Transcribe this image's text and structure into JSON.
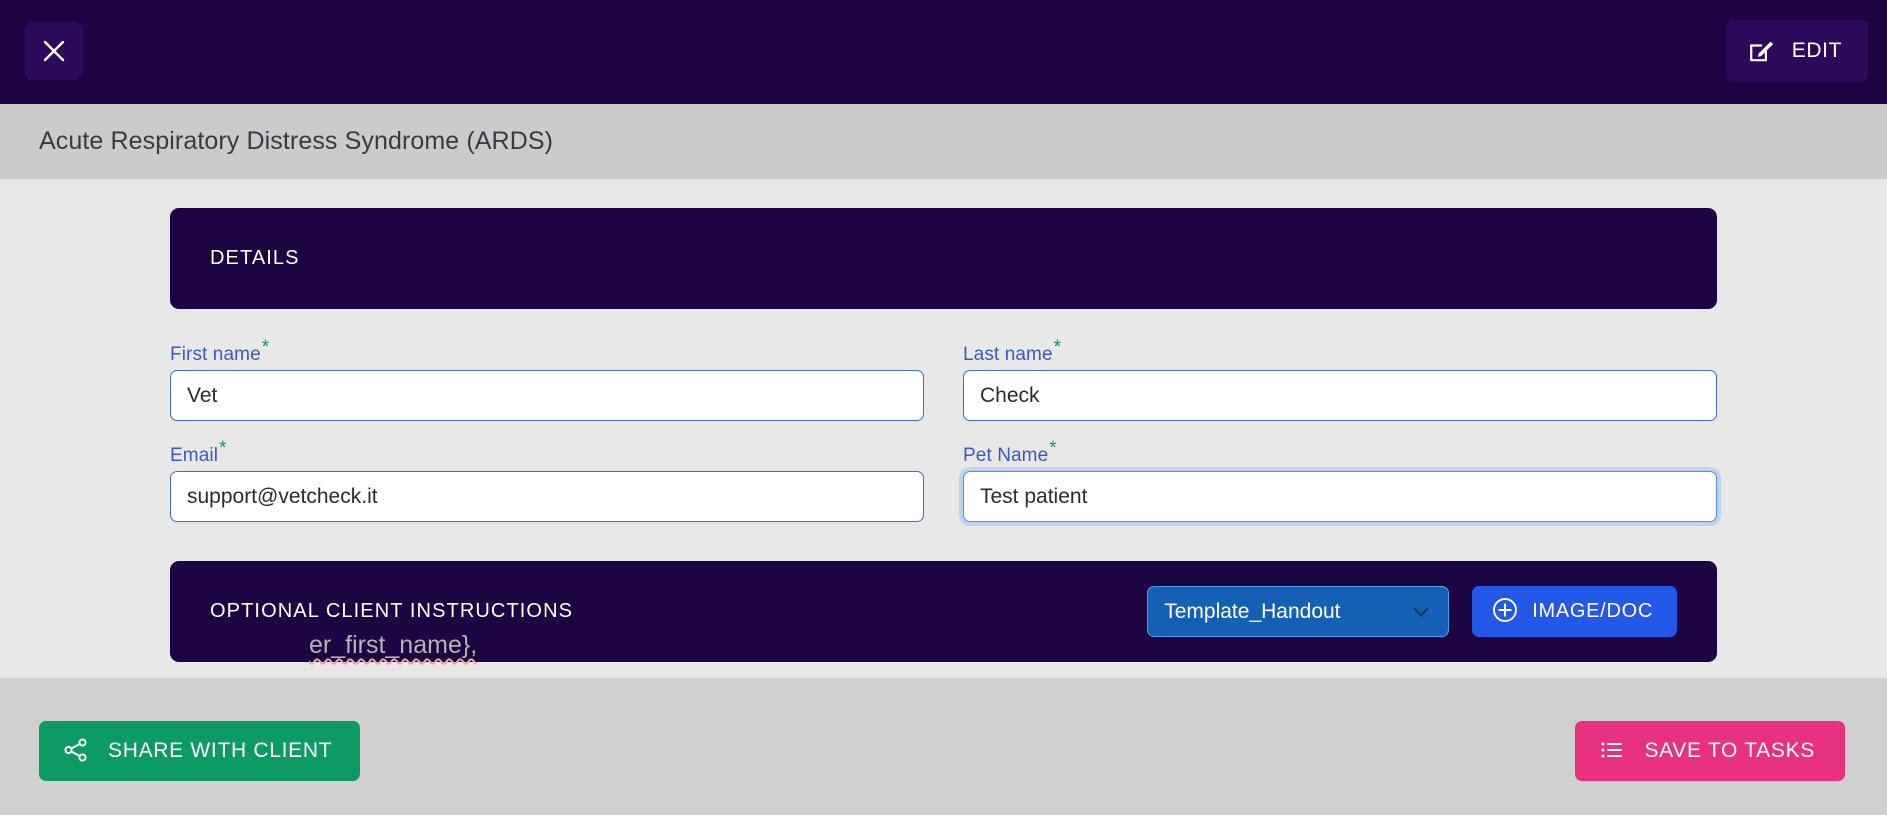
{
  "topbar": {
    "close_icon": "close-icon",
    "edit_icon": "edit-pencil-icon",
    "edit_label": "EDIT"
  },
  "header": {
    "title": "Acute Respiratory Distress Syndrome (ARDS)"
  },
  "details_section": {
    "heading": "DETAILS",
    "fields": [
      {
        "label": "First name",
        "required_marker": "*",
        "value": "Vet",
        "placeholder": "",
        "focused": false,
        "name": "first-name"
      },
      {
        "label": "Last name",
        "required_marker": "*",
        "value": "Check",
        "placeholder": "",
        "focused": false,
        "name": "last-name"
      },
      {
        "label": "Email",
        "required_marker": "*",
        "value": "support@vetcheck.it",
        "placeholder": "",
        "focused": false,
        "name": "email"
      },
      {
        "label": "Pet Name",
        "required_marker": "*",
        "value": "Test patient",
        "placeholder": "",
        "focused": true,
        "name": "pet-name"
      }
    ]
  },
  "instructions_section": {
    "heading": "OPTIONAL CLIENT INSTRUCTIONS",
    "template_select": {
      "selected": "Template_Handout",
      "chevron_icon": "chevron-down-icon"
    },
    "image_doc_button": {
      "label": "IMAGE/DOC",
      "icon": "plus-circle-icon"
    }
  },
  "obscured_content": {
    "partial_text": "er_first_name},"
  },
  "footer": {
    "share_button": {
      "label": "SHARE WITH CLIENT",
      "icon": "share-nodes-icon"
    },
    "save_button": {
      "label": "SAVE TO TASKS",
      "icon": "list-icon"
    }
  },
  "colors": {
    "brand_purple": "#1d0442",
    "accent_blue": "#3b6fd4",
    "required_green": "#0f9a5f",
    "share_green": "#0d9a65",
    "save_pink": "#e8317f",
    "select_blue": "#1560b6",
    "imagedoc_blue": "#2358e8",
    "titlebar_gray": "#cbcbcb",
    "footer_gray": "#d0d0d0",
    "body_gray": "#e8e8e8"
  }
}
